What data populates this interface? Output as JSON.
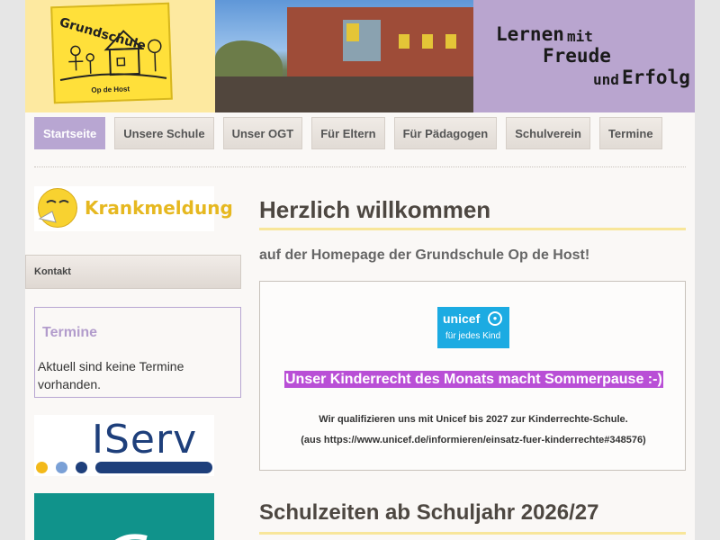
{
  "header": {
    "logo": {
      "name": "Grundschule",
      "sub": "Op de Host"
    },
    "motto": {
      "line1_a": "Lernen",
      "line1_b": "mit",
      "line2": "Freude",
      "line3_a": "und",
      "line3_b": "Erfolg"
    }
  },
  "nav": {
    "items": [
      {
        "label": "Startseite"
      },
      {
        "label": "Unsere Schule"
      },
      {
        "label": "Unser OGT"
      },
      {
        "label": "Für Eltern"
      },
      {
        "label": "Für Pädagogen"
      },
      {
        "label": "Schulverein"
      },
      {
        "label": "Termine"
      }
    ]
  },
  "sidebar": {
    "krankmeldung": "Krankmeldung",
    "kontakt": "Kontakt",
    "termine": {
      "title": "Termine",
      "text": "Aktuell sind keine Termine vorhanden."
    },
    "iserv": "IServ"
  },
  "main": {
    "title": "Herzlich willkommen",
    "intro": "auf der Homepage der Grundschule Op de Host!",
    "unicef": {
      "word": "unicef",
      "sub": "für jedes Kind"
    },
    "highlight": "Unser Kinderrecht des Monats macht Sommerpause :-)",
    "qualify": "Wir qualifizieren uns mit Unicef bis 2027 zur Kinderrechte-Schule.",
    "source": "(aus https://www.unicef.de/informieren/einsatz-fuer-kinderrechte#348576)",
    "section2": "Schulzeiten ab Schuljahr 2026/27"
  },
  "colors": {
    "accent": "#b8a6d2",
    "logo_bg": "#fde9a0",
    "highlight": "#b94fd6",
    "unicef": "#1cabe2",
    "heading_rule": "#f8e69a"
  }
}
